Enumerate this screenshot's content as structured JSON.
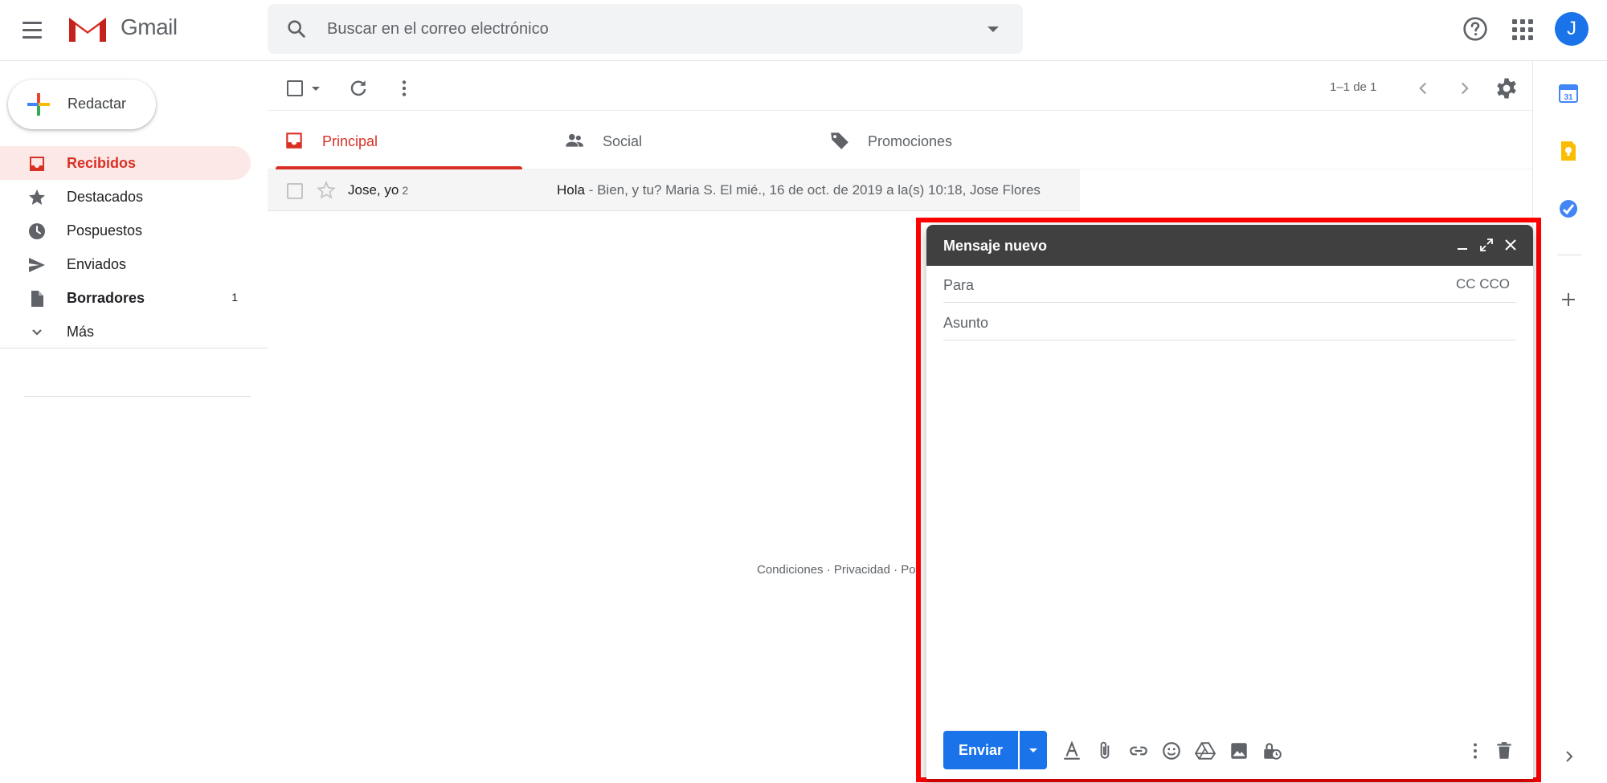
{
  "header": {
    "app_name": "Gmail",
    "search_placeholder": "Buscar en el correo electrónico",
    "avatar_initial": "J"
  },
  "sidebar": {
    "compose_label": "Redactar",
    "items": [
      {
        "label": "Recibidos",
        "icon": "inbox-icon",
        "active": true
      },
      {
        "label": "Destacados",
        "icon": "star-icon"
      },
      {
        "label": "Pospuestos",
        "icon": "clock-icon"
      },
      {
        "label": "Enviados",
        "icon": "send-icon"
      },
      {
        "label": "Borradores",
        "icon": "draft-icon",
        "count": "1",
        "bold": true
      },
      {
        "label": "Más",
        "icon": "chevron-down-icon"
      }
    ]
  },
  "toolbar": {
    "pager_text": "1–1 de 1"
  },
  "tabs": [
    {
      "label": "Principal",
      "icon": "inbox-icon",
      "active": true
    },
    {
      "label": "Social",
      "icon": "people-icon"
    },
    {
      "label": "Promociones",
      "icon": "tag-icon"
    }
  ],
  "emails": [
    {
      "sender": "Jose, yo",
      "count": "2",
      "subject": "Hola",
      "snippet": " - Bien, y tu? Maria S. El mié., 16 de oct. de 2019 a la(s) 10:18, Jose Flores"
    }
  ],
  "footer": {
    "links": "Condiciones · Privacidad · Po"
  },
  "compose": {
    "title": "Mensaje nuevo",
    "to_placeholder": "Para",
    "cc_links": "CC CCO",
    "subject_placeholder": "Asunto",
    "send_label": "Enviar"
  },
  "colors": {
    "accent_red": "#d93025",
    "brand_blue": "#1a73e8",
    "compose_header": "#404040",
    "highlight": "#ff0000"
  }
}
